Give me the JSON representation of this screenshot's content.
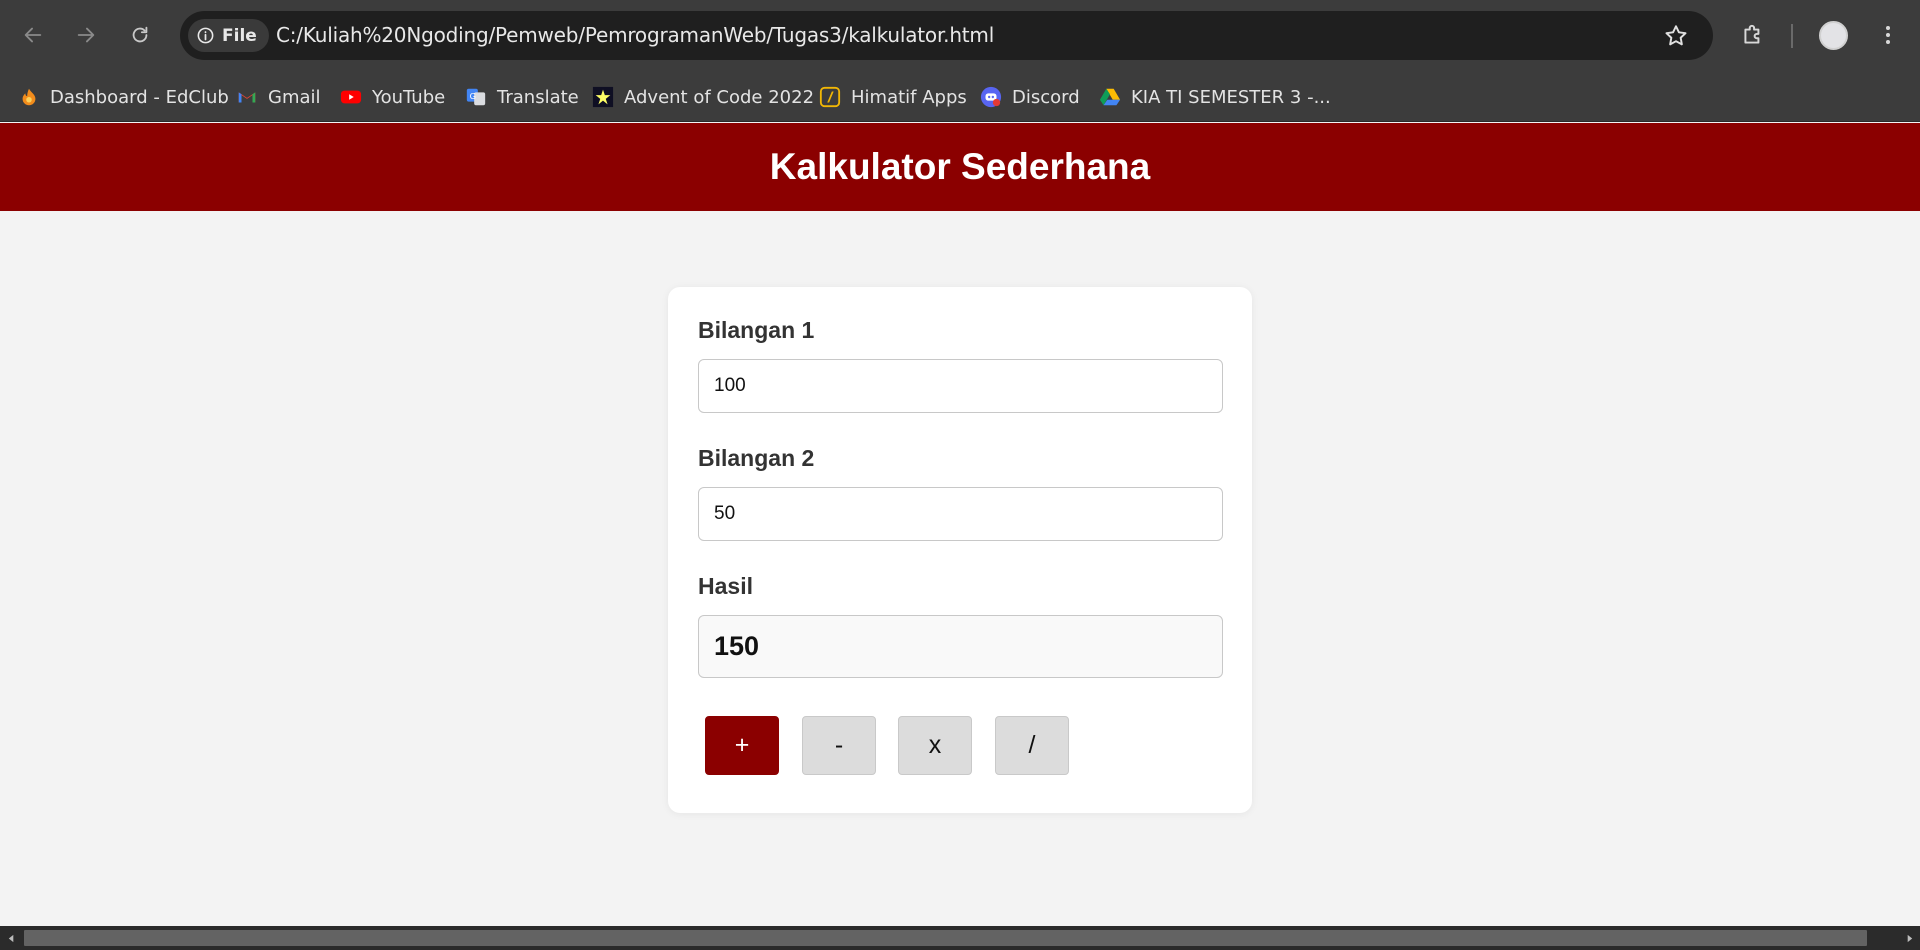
{
  "browser": {
    "url": "C:/Kuliah%20Ngoding/Pemweb/PemrogramanWeb/Tugas3/kalkulator.html",
    "chip_label": "File",
    "bookmarks": [
      {
        "label": "Dashboard - EdClub",
        "icon": "edclub-icon"
      },
      {
        "label": "Gmail",
        "icon": "gmail-icon"
      },
      {
        "label": "YouTube",
        "icon": "youtube-icon"
      },
      {
        "label": "Translate",
        "icon": "translate-icon"
      },
      {
        "label": "Advent of Code 2022",
        "icon": "advent-of-code-icon"
      },
      {
        "label": "Himatif Apps",
        "icon": "himatif-icon"
      },
      {
        "label": "Discord",
        "icon": "discord-icon"
      },
      {
        "label": "KIA TI SEMESTER 3 -...",
        "icon": "google-drive-icon"
      }
    ]
  },
  "page": {
    "title": "Kalkulator Sederhana",
    "bilangan1_label": "Bilangan 1",
    "bilangan1_value": "100",
    "bilangan2_label": "Bilangan 2",
    "bilangan2_value": "50",
    "hasil_label": "Hasil",
    "hasil_value": "150",
    "operators": [
      "+",
      "-",
      "x",
      "/"
    ],
    "active_operator": "+"
  },
  "colors": {
    "header_bg": "#8b0000",
    "active_button": "#8b0000",
    "page_bg": "#f3f3f3"
  }
}
